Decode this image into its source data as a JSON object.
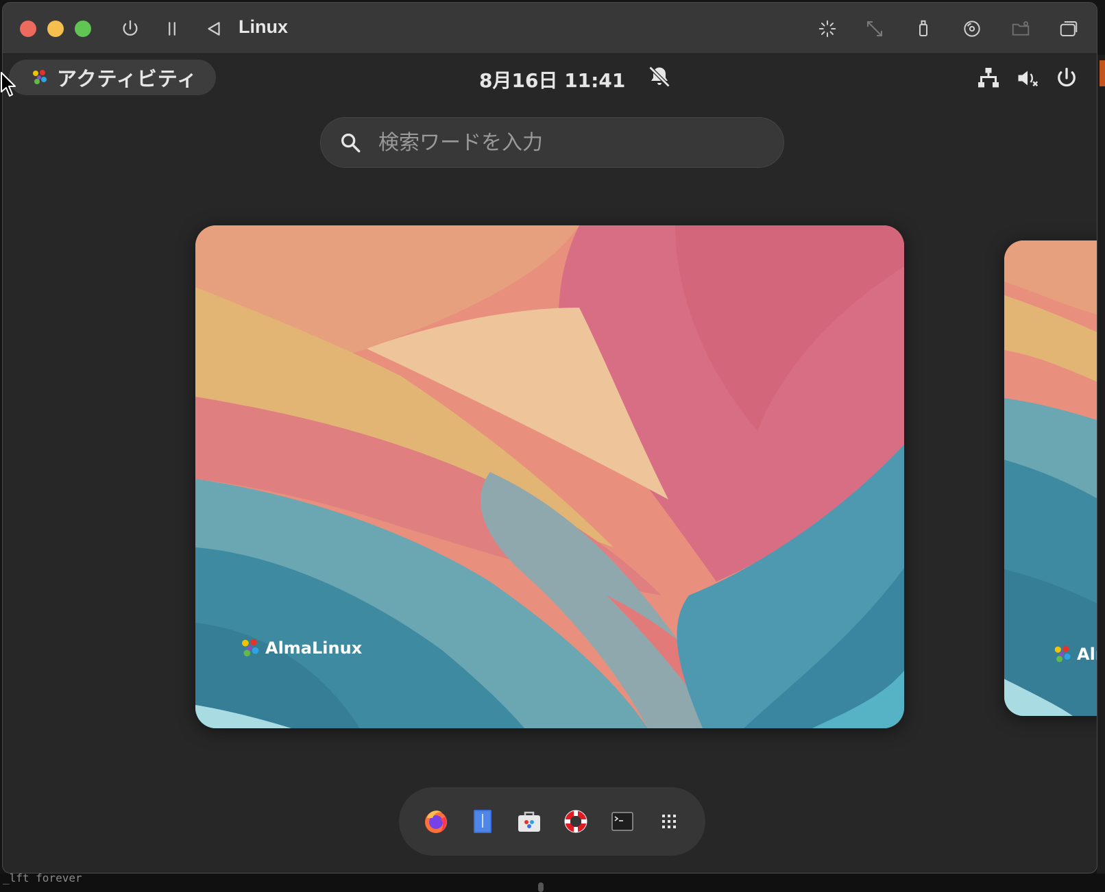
{
  "window": {
    "title": "Linux"
  },
  "gnome": {
    "activities_label": "アクティビティ",
    "clock": "8月16日  11:41"
  },
  "search": {
    "placeholder": "検索ワードを入力"
  },
  "workspace": {
    "logo_text": "AlmaLinux",
    "logo_text_partial": "Alm"
  },
  "background": {
    "terminal_text": "_lft forever"
  },
  "dash": {
    "items": [
      {
        "name": "firefox",
        "icon": "firefox-icon"
      },
      {
        "name": "text-editor",
        "icon": "text-editor-icon"
      },
      {
        "name": "software",
        "icon": "software-icon"
      },
      {
        "name": "help",
        "icon": "help-icon"
      },
      {
        "name": "terminal",
        "icon": "terminal-icon"
      },
      {
        "name": "show-apps",
        "icon": "app-grid-icon"
      }
    ]
  },
  "colors": {
    "traffic_close": "#ed6a5e",
    "traffic_min": "#f5bf4f",
    "traffic_max": "#61c554",
    "titlebar": "#383838",
    "shell_bg": "#272727"
  }
}
